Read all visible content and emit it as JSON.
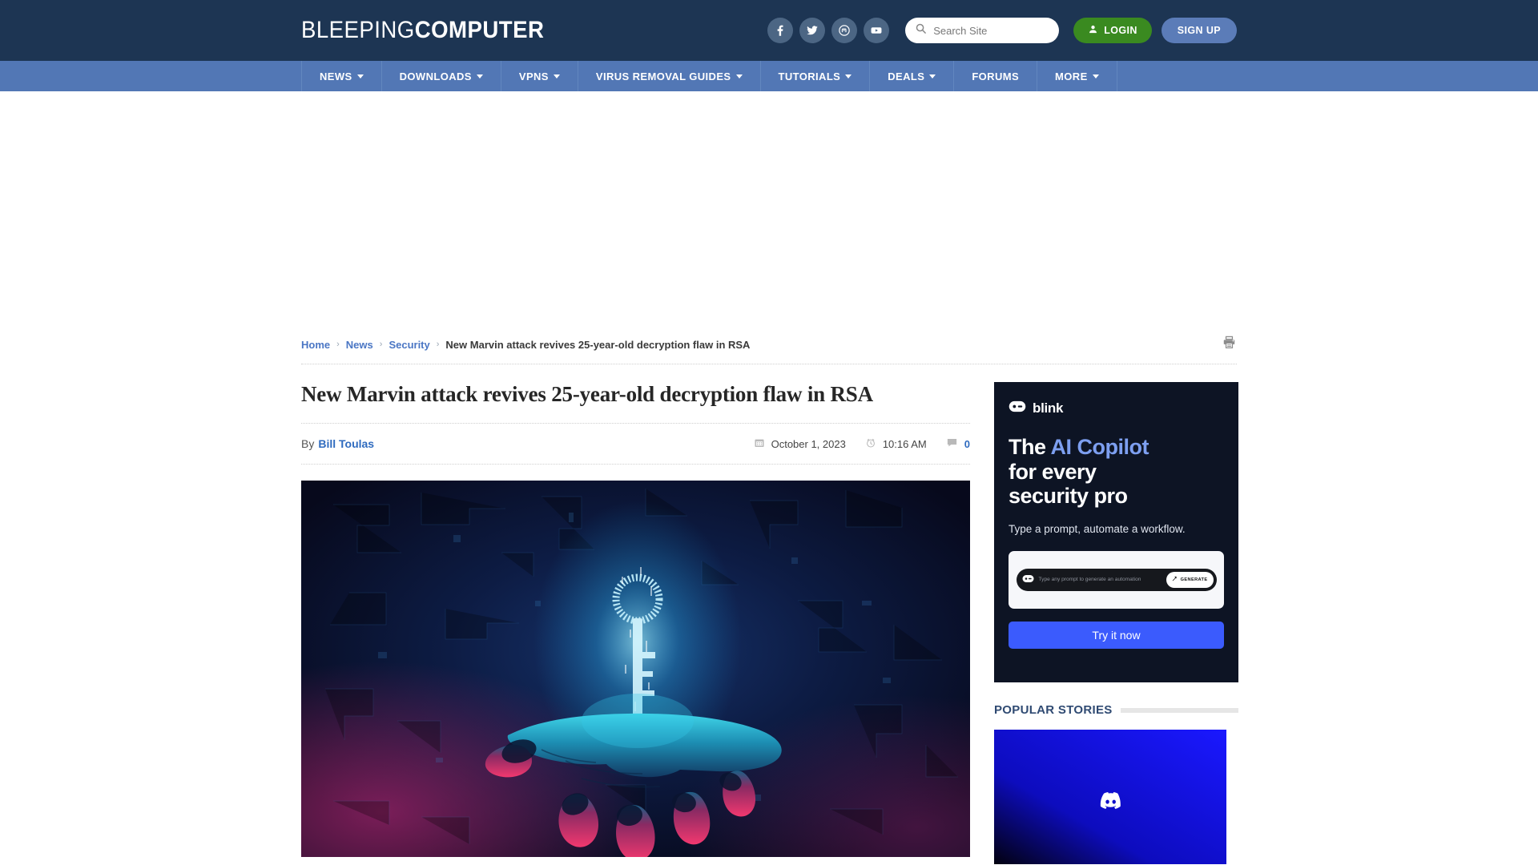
{
  "header": {
    "logo_light": "BLEEPING",
    "logo_bold": "COMPUTER",
    "social": [
      {
        "name": "facebook-icon",
        "label": "Facebook"
      },
      {
        "name": "twitter-icon",
        "label": "Twitter"
      },
      {
        "name": "mastodon-icon",
        "label": "Mastodon"
      },
      {
        "name": "youtube-icon",
        "label": "YouTube"
      }
    ],
    "search": {
      "placeholder": "Search Site",
      "value": "",
      "icon": "search-icon"
    },
    "login_label": "LOGIN",
    "login_icon": "user-icon",
    "signup_label": "SIGN UP",
    "login_color": "#3a8a20",
    "signup_color": "#5b7cb8",
    "background": "#1d3553"
  },
  "nav": {
    "background": "#5277b5",
    "items": [
      {
        "label": "NEWS",
        "caret": true
      },
      {
        "label": "DOWNLOADS",
        "caret": true
      },
      {
        "label": "VPNS",
        "caret": true
      },
      {
        "label": "VIRUS REMOVAL GUIDES",
        "caret": true
      },
      {
        "label": "TUTORIALS",
        "caret": true
      },
      {
        "label": "DEALS",
        "caret": true
      },
      {
        "label": "FORUMS",
        "caret": false
      },
      {
        "label": "MORE",
        "caret": true
      }
    ]
  },
  "breadcrumb": {
    "home": "Home",
    "news": "News",
    "security": "Security",
    "current": "New Marvin attack revives 25-year-old decryption flaw in RSA",
    "separator": "›",
    "print_icon": "printer-icon"
  },
  "article": {
    "headline": "New Marvin attack revives 25-year-old decryption flaw in RSA",
    "by_label": "By",
    "author": "Bill Toulas",
    "date": "October 1, 2023",
    "date_icon": "calendar-icon",
    "time": "10:16 AM",
    "time_icon": "clock-icon",
    "comments": "0",
    "comments_icon": "comment-icon",
    "hero_alt": "Glowing digital key hovering above an open hand"
  },
  "sidebar": {
    "ad": {
      "brand": "blink",
      "brand_icon": "blink-robot-icon",
      "headline_1": "The ",
      "headline_highlight": "AI Copilot",
      "headline_2": "for every",
      "headline_3": "security pro",
      "subtitle": "Type a prompt, automate a workflow.",
      "prompt_placeholder": "Type any prompt to generate an automation",
      "prompt_icon": "blink-robot-icon",
      "generate_label": "GENERATE",
      "generate_icon": "wand-icon",
      "cta_label": "Try it now",
      "cta_color": "#3b5bfd",
      "background": "#0d1424",
      "highlight_color": "#7d9ff0"
    },
    "popular": {
      "title": "POPULAR STORIES",
      "thumb_alt": "Discord logo on blue gradient background"
    }
  }
}
